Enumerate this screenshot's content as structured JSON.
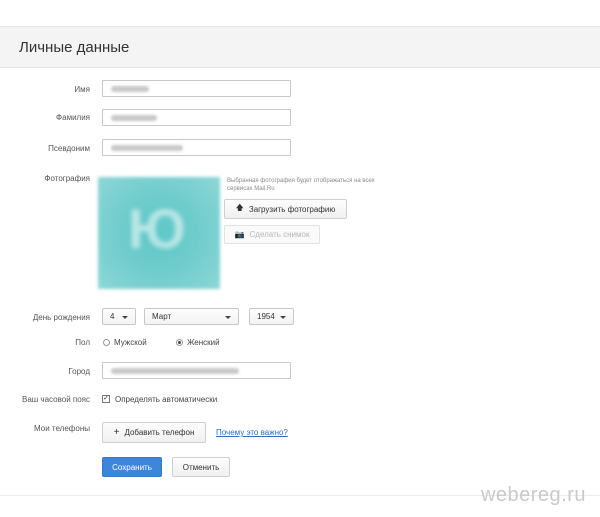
{
  "header": {
    "title": "Личные данные"
  },
  "fields": {
    "name_label": "Имя",
    "surname_label": "Фамилия",
    "nickname_label": "Псевдоним",
    "photo_label": "Фотография",
    "birthday_label": "День рождения",
    "gender_label": "Пол",
    "city_label": "Город",
    "timezone_label": "Ваш часовой пояс",
    "phones_label": "Мои телефоны"
  },
  "photo": {
    "hint": "Выбранная фотография будет отображаться на всех сервисах Mail.Ru",
    "letters": "Ю",
    "upload_label": "Загрузить фотографию",
    "snapshot_label": "Сделать снимок"
  },
  "birthday": {
    "day": "4",
    "month": "Март",
    "year": "1954"
  },
  "gender": {
    "male_label": "Мужской",
    "female_label": "Женский",
    "selected": "female"
  },
  "timezone": {
    "auto_label": "Определять автоматически",
    "checked": true
  },
  "phones": {
    "add_label": "Добавить телефон",
    "why_link": "Почему это важно?"
  },
  "actions": {
    "save_label": "Сохранить",
    "cancel_label": "Отменить"
  },
  "watermark": "webereg.ru",
  "colors": {
    "primary": "#3d86d8",
    "link": "#2a6ec2",
    "photo": "#6fcccc"
  }
}
